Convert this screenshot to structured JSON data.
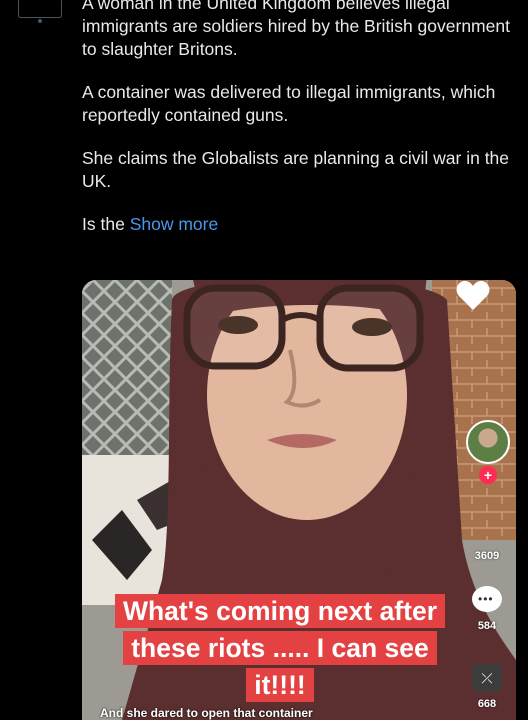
{
  "tweet": {
    "paragraphs": [
      "A woman in the United Kingdom believes illegal immigrants are soldiers hired by the British government to slaughter Britons.",
      "A container was delivered to illegal immigrants, which reportedly contained guns.",
      "She claims the Globalists are planning a civil war in the UK."
    ],
    "truncated_text": "Is the",
    "show_more_label": "Show more"
  },
  "video": {
    "caption": "What's coming next after these riots ..... I can see it!!!!",
    "subcaption": "And she dared to open that container",
    "likes": "3609",
    "comments": "584",
    "shares": "668",
    "icons": [
      "creator-avatar",
      "follow-plus-icon",
      "heart-icon",
      "comment-icon",
      "share-icon"
    ]
  }
}
